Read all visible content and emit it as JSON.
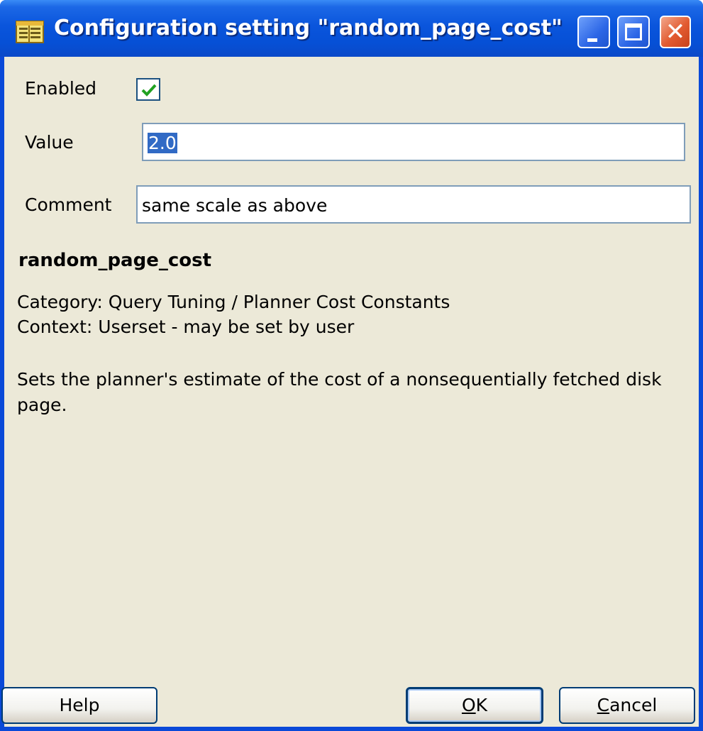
{
  "window": {
    "title": "Configuration setting \"random_page_cost\"",
    "title_icon": "notepad-icon",
    "buttons": {
      "minimize": "minimize-icon",
      "maximize": "maximize-icon",
      "close": "close-icon"
    }
  },
  "form": {
    "enabled_label": "Enabled",
    "enabled_checked": true,
    "value_label": "Value",
    "value": "2.0",
    "comment_label": "Comment",
    "comment": "same scale as above"
  },
  "help": {
    "name": "random_page_cost",
    "category": "Category: Query Tuning / Planner Cost Constants",
    "context": "Context: Userset - may be set by user",
    "description_line1": "Sets the planner's estimate of the cost of a nonsequentially fetched disk",
    "description_line2": "page."
  },
  "buttons": {
    "help": "Help",
    "ok_accel": "O",
    "ok_rest": "K",
    "cancel_accel": "C",
    "cancel_rest": "ancel"
  },
  "colors": {
    "titlebar": "#0a55dc",
    "dialog_bg": "#ece9d8",
    "selection": "#316ac5",
    "check": "#21a121",
    "close_button": "#e25a30"
  }
}
